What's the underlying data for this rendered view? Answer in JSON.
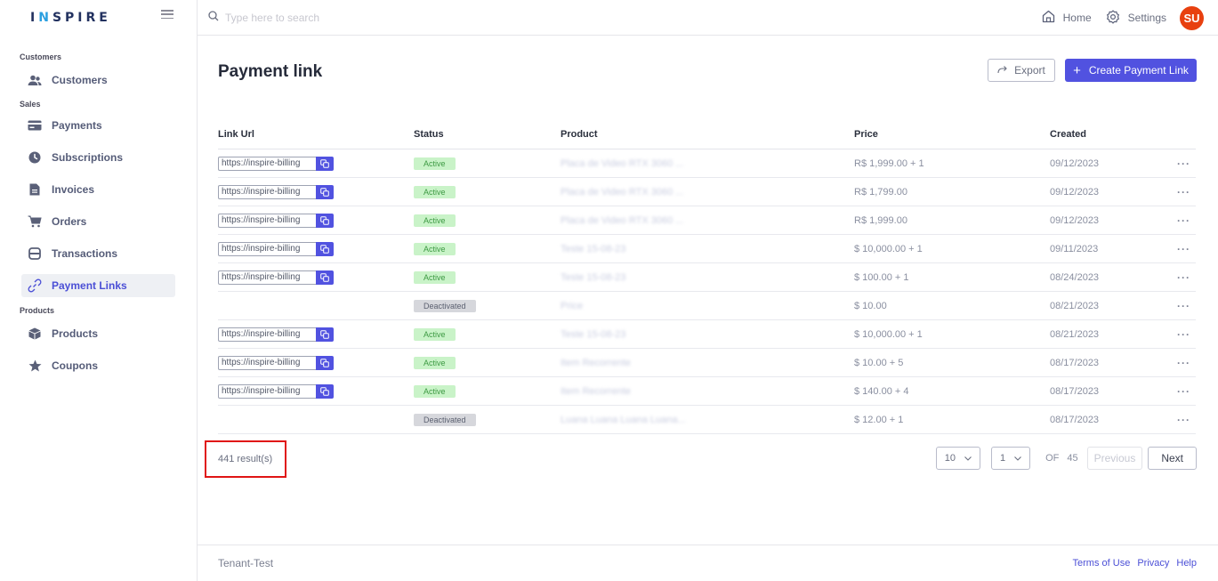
{
  "brand": {
    "logo_prefix": "I",
    "logo_accent": "N",
    "logo_rest": "SPIRE"
  },
  "sidebar": {
    "sections": [
      {
        "label": "Customers",
        "items": [
          {
            "label": "Customers",
            "icon": "users-icon",
            "active": false
          }
        ]
      },
      {
        "label": "Sales",
        "items": [
          {
            "label": "Payments",
            "icon": "credit-card-icon",
            "active": false
          },
          {
            "label": "Subscriptions",
            "icon": "clock-icon",
            "active": false
          },
          {
            "label": "Invoices",
            "icon": "document-icon",
            "active": false
          },
          {
            "label": "Orders",
            "icon": "cart-icon",
            "active": false
          },
          {
            "label": "Transactions",
            "icon": "bank-icon",
            "active": false
          },
          {
            "label": "Payment Links",
            "icon": "link-icon",
            "active": true
          }
        ]
      },
      {
        "label": "Products",
        "items": [
          {
            "label": "Products",
            "icon": "box-icon",
            "active": false
          },
          {
            "label": "Coupons",
            "icon": "star-icon",
            "active": false
          }
        ]
      }
    ]
  },
  "header": {
    "search_placeholder": "Type here to search",
    "home_label": "Home",
    "settings_label": "Settings",
    "avatar_initials": "SU",
    "avatar_color": "#e8400f"
  },
  "page": {
    "title": "Payment link",
    "export_label": "Export",
    "create_label": "Create Payment Link",
    "accent_color": "#5152e0"
  },
  "table": {
    "columns": [
      "Link Url",
      "Status",
      "Product",
      "Price",
      "Created"
    ],
    "rows": [
      {
        "link": "https://inspire-billing",
        "status": "Active",
        "product": "Placa de Video RTX 3060 ...",
        "price": "R$ 1,999.00 + 1",
        "created": "09/12/2023"
      },
      {
        "link": "https://inspire-billing",
        "status": "Active",
        "product": "Placa de Video RTX 3060 ...",
        "price": "R$ 1,799.00",
        "created": "09/12/2023"
      },
      {
        "link": "https://inspire-billing",
        "status": "Active",
        "product": "Placa de Video RTX 3060 ...",
        "price": "R$ 1,999.00",
        "created": "09/12/2023"
      },
      {
        "link": "https://inspire-billing",
        "status": "Active",
        "product": "Teste 15-08-23",
        "price": "$ 10,000.00 + 1",
        "created": "09/11/2023"
      },
      {
        "link": "https://inspire-billing",
        "status": "Active",
        "product": "Teste 15-08-23",
        "price": "$ 100.00 + 1",
        "created": "08/24/2023"
      },
      {
        "link": "",
        "status": "Deactivated",
        "product": "Price",
        "price": "$ 10.00",
        "created": "08/21/2023"
      },
      {
        "link": "https://inspire-billing",
        "status": "Active",
        "product": "Teste 15-08-23",
        "price": "$ 10,000.00 + 1",
        "created": "08/21/2023"
      },
      {
        "link": "https://inspire-billing",
        "status": "Active",
        "product": "Item Recorrente",
        "price": "$ 10.00 + 5",
        "created": "08/17/2023"
      },
      {
        "link": "https://inspire-billing",
        "status": "Active",
        "product": "Item Recorrente",
        "price": "$ 140.00 + 4",
        "created": "08/17/2023"
      },
      {
        "link": "",
        "status": "Deactivated",
        "product": "Luana Luana Luana Luana...",
        "price": "$ 12.00 + 1",
        "created": "08/17/2023"
      }
    ],
    "row_action": "···"
  },
  "pagination": {
    "results_text": "441 result(s)",
    "page_size": "10",
    "current_page": "1",
    "of_label": "OF",
    "total_pages": "45",
    "previous_label": "Previous",
    "next_label": "Next"
  },
  "footer": {
    "tenant": "Tenant-Test",
    "links": [
      "Terms of Use",
      "Privacy",
      "Help"
    ]
  }
}
